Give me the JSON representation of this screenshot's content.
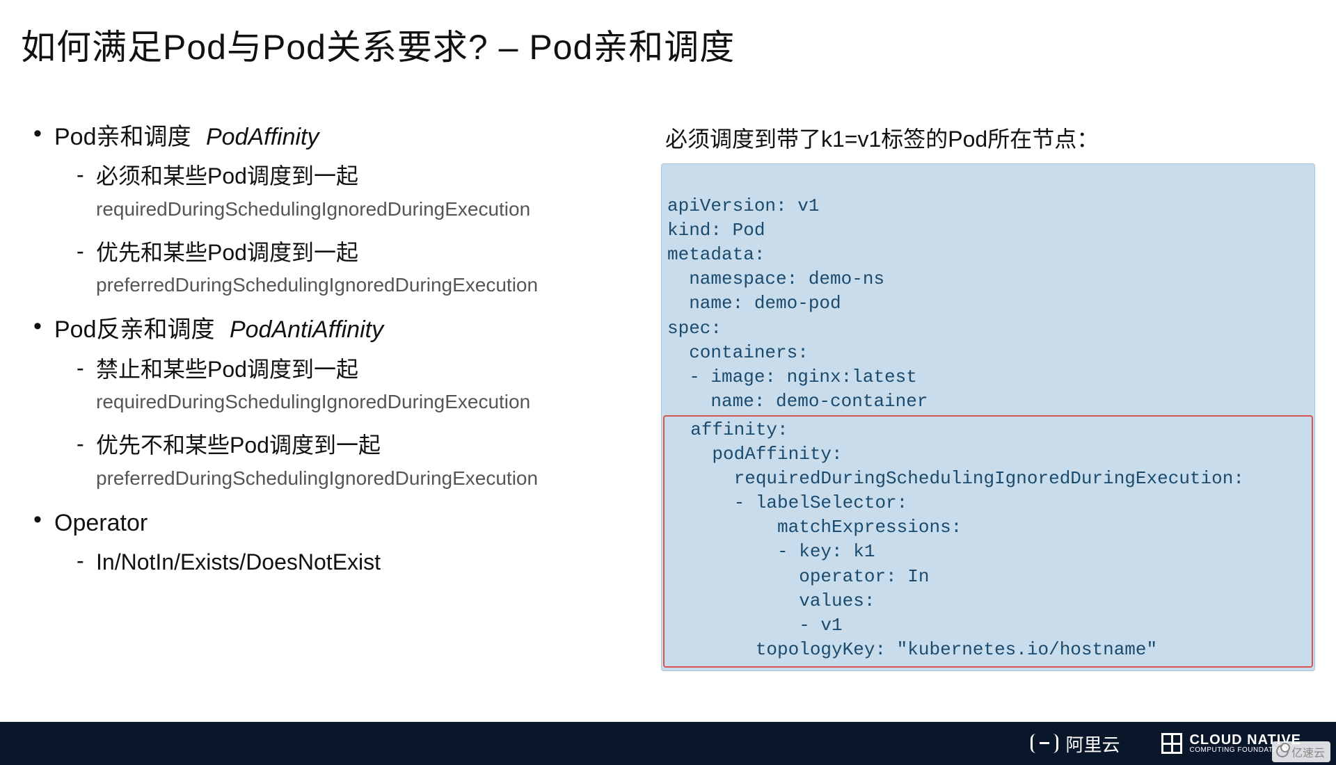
{
  "title": "如何满足Pod与Pod关系要求?   – Pod亲和调度",
  "left": {
    "items": [
      {
        "label": "Pod亲和调度",
        "term": "PodAffinity",
        "subs": [
          {
            "label": "必须和某些Pod调度到一起",
            "desc": "requiredDuringSchedulingIgnoredDuringExecution"
          },
          {
            "label": "优先和某些Pod调度到一起",
            "desc": "preferredDuringSchedulingIgnoredDuringExecution"
          }
        ]
      },
      {
        "label": "Pod反亲和调度",
        "term": "PodAntiAffinity",
        "subs": [
          {
            "label": "禁止和某些Pod调度到一起",
            "desc": "requiredDuringSchedulingIgnoredDuringExecution"
          },
          {
            "label": "优先不和某些Pod调度到一起",
            "desc": "preferredDuringSchedulingIgnoredDuringExecution"
          }
        ]
      },
      {
        "label": "Operator",
        "term": "",
        "subs": [
          {
            "label": "In/NotIn/Exists/DoesNotExist",
            "desc": ""
          }
        ]
      }
    ]
  },
  "right": {
    "heading": "必须调度到带了k1=v1标签的Pod所在节点：",
    "code_top": "apiVersion: v1\nkind: Pod\nmetadata:\n  namespace: demo-ns\n  name: demo-pod\nspec:\n  containers:\n  - image: nginx:latest\n    name: demo-container",
    "code_highlight": "  affinity:\n    podAffinity:\n      requiredDuringSchedulingIgnoredDuringExecution:\n      - labelSelector:\n          matchExpressions:\n          - key: k1\n            operator: In\n            values:\n            - v1\n        topologyKey: \"kubernetes.io/hostname\""
  },
  "footer": {
    "aliyun": "阿里云",
    "cncf_main": "CLOUD NATIVE",
    "cncf_sub": "COMPUTING FOUNDATION"
  },
  "watermark": "亿速云"
}
